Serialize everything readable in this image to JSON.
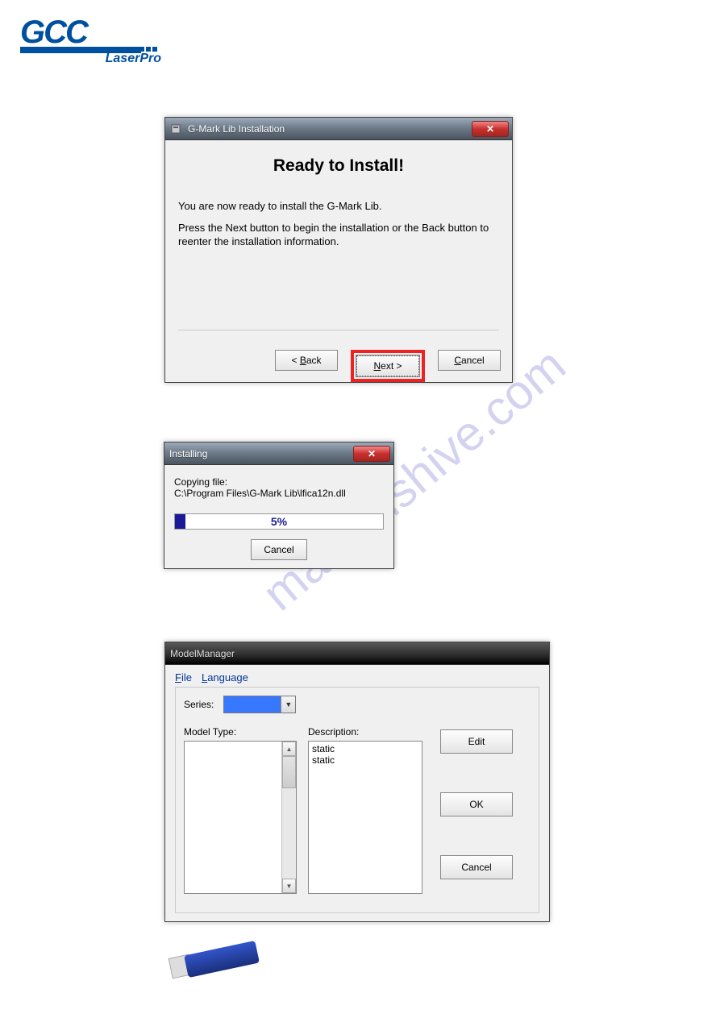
{
  "logo": {
    "main": "GCC",
    "sub": "LaserPro"
  },
  "watermark": "manualshive.com",
  "dialog1": {
    "title": "G-Mark Lib Installation",
    "heading": "Ready to Install!",
    "line1": "You are now ready to install the G-Mark Lib.",
    "line2": "Press the Next button to begin the installation or the Back button to reenter the installation information.",
    "back": "< Back",
    "next": "Next >",
    "cancel": "Cancel"
  },
  "dialog2": {
    "title": "Installing",
    "copying": "Copying file:",
    "file": "C:\\Program Files\\G-Mark Lib\\lfica12n.dll",
    "percent": "5%",
    "percent_width": "5%",
    "cancel": "Cancel"
  },
  "dialog3": {
    "title": "ModelManager",
    "menu_file": "File",
    "menu_language": "Language",
    "series_label": "Series:",
    "model_type_label": "Model Type:",
    "description_label": "Description:",
    "desc_line1": "static",
    "desc_line2": "static",
    "edit": "Edit",
    "ok": "OK",
    "cancel": "Cancel"
  }
}
